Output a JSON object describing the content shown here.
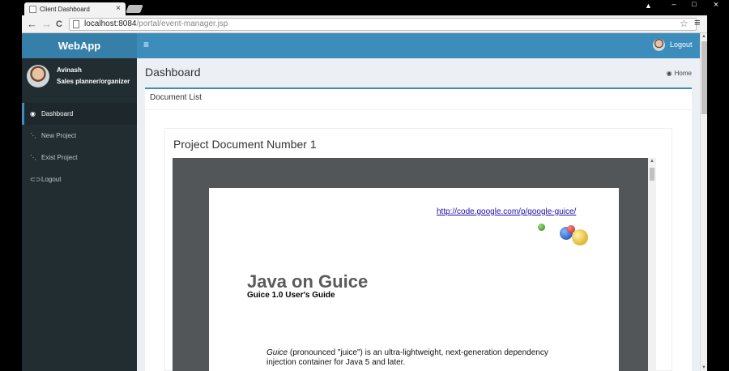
{
  "browser": {
    "tab_title": "Client Dashboard",
    "tab_close": "×",
    "url_host": "localhost:8084",
    "url_path": "/portal/event-manager.jsp",
    "nav_back": "←",
    "nav_forward": "→",
    "nav_reload": "C",
    "star": "☆",
    "menu": "≡"
  },
  "app": {
    "logo": "WebApp",
    "hamburger": "≡",
    "logout_label": "Logout"
  },
  "user": {
    "name": "Avinash",
    "role": "Sales planner/organizer"
  },
  "sidebar": {
    "items": [
      {
        "label": "Dashboard",
        "icon": "dashboard-icon",
        "glyph": "◉",
        "active": true
      },
      {
        "label": "New Project",
        "icon": "rss-icon",
        "glyph": "⋱",
        "active": false
      },
      {
        "label": "Exist Project",
        "icon": "rss-icon",
        "glyph": "⋱",
        "active": false
      },
      {
        "label": "Logout",
        "icon": "toggle-icon",
        "glyph": "⊂⊃",
        "active": false
      }
    ]
  },
  "content": {
    "title": "Dashboard",
    "breadcrumb_home": "Home",
    "breadcrumb_icon": "◉",
    "box_title": "Document List",
    "document_title": "Project Document Number 1"
  },
  "pdf": {
    "link": "http://code.google.com/p/google-guice/",
    "heading": "Java on Guice",
    "subheading": "Guice 1.0 User's Guide",
    "body_em": "Guice",
    "body_line1": " (pronounced \"juice\") is an ultra-lightweight, next-generation dependency",
    "body_line2": "injection container for Java 5 and later."
  },
  "colors": {
    "header_blue": "#3c8dbc",
    "logo_blue": "#367fa9",
    "sidebar_dark": "#222d32"
  }
}
